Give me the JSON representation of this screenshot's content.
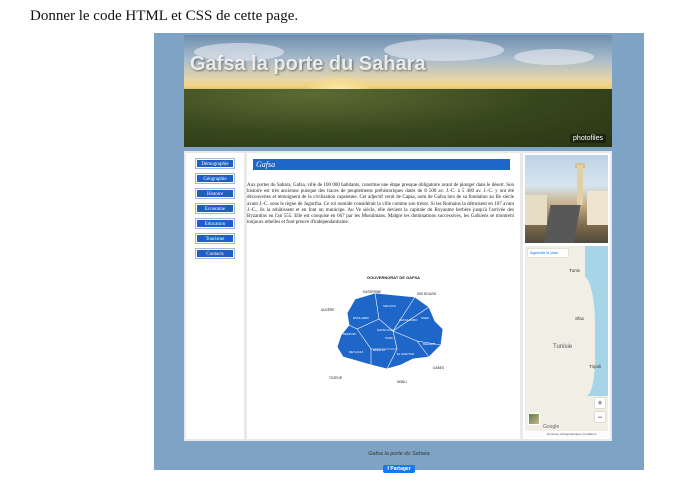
{
  "instruction": "Donner le code HTML et CSS de cette page.",
  "banner": {
    "title": "Gafsa la porte du Sahara",
    "logo": "photofiles"
  },
  "nav": {
    "items": [
      "Démographie",
      "Géographie",
      "Histoire",
      "Economie",
      "Education",
      "Tourisme",
      "Contacts"
    ]
  },
  "content": {
    "heading": "Gafsa",
    "paragraph": "Aux portes du Sahara, Gafsa, ville de 100 000 habitants, constitue une étape presque obligatoire avant de plonger dans le désert. Son histoire est très ancienne puisque des traces de peuplements préhistoriques datés de 8 500 av. J.-C. à 5 400 av. J.-C. y ont été découvertes et témoignent de la civilisation capsienne. Cet adjectif venit de Capsa, nom de Gafsa lors de sa fondation au IIe siècle avant J.-C. sous le règne de Jugurtha. Ce roi numide considérait la ville comme son trésor. Si les Romains la détruisent en 107 avant J.-C., ils la rebâtissent et en font un municipe. Au Ve siècle, elle devient la capitale du Royaume berbère jusqu'à l'arrivée des Byzantins en l'an 555. Elle est conquise en 667 par les Musulmans. Malgré les dominations successives, les Gafsiens se montrent toujours rebelles et font preuve d'indépendantisme."
  },
  "map": {
    "title": "GOUVERNORAT DE GAFSA",
    "outside": [
      "KASSERINE",
      "SIDI BOUZID",
      "AUGÈRE",
      "GABES",
      "TOZEUR",
      "KEBILI"
    ],
    "regions": [
      "SIDI AICH",
      "MOULARES",
      "GAFSA NORD",
      "SNED",
      "REDEYEF",
      "GAFSA SUD",
      "KSAR",
      "MDHILLA",
      "METLAOUI",
      "EL GUETTAR",
      "BELKHIR"
    ]
  },
  "google_map": {
    "view_label": "Agrandir le plan",
    "labels": [
      "Tunis",
      "Sfax",
      "Tunisie",
      "Tripoli"
    ],
    "zoom_in": "+",
    "zoom_out": "−",
    "google": "Google",
    "footer": "Données cartographiques   Conditions d'utilisation"
  },
  "footer": {
    "text": "Gafsa la porte du Sahara",
    "share": "Partager"
  },
  "colors": {
    "outer_bg": "#7fa3c4",
    "nav_button": "#1f5fc4",
    "heading_bar": "#1f66c9",
    "map_fill": "#1f66c9"
  }
}
